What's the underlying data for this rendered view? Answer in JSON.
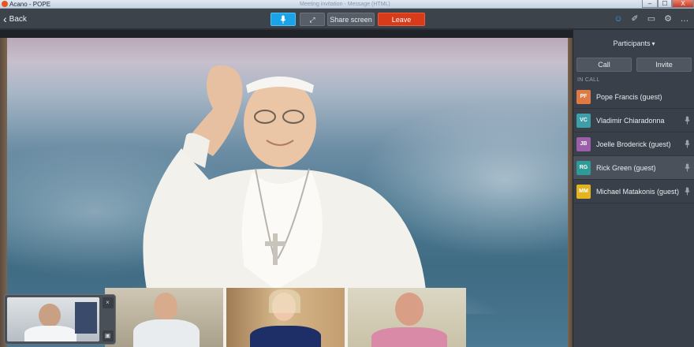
{
  "window": {
    "title": "Acano - POPE",
    "faint_title": "Meeting invitation - Message (HTML)",
    "min_symbol": "‒",
    "max_symbol": "☐",
    "close_symbol": "X"
  },
  "toolbar": {
    "back_label": "Back",
    "back_symbol": "‹",
    "mic_symbol": "↓",
    "expand_symbol": "⤢",
    "share_label": "Share screen",
    "leave_label": "Leave"
  },
  "top_icons": [
    {
      "icon": "participants-icon",
      "glyph": "☺"
    },
    {
      "icon": "chat-icon",
      "glyph": "✐"
    },
    {
      "icon": "screen-icon",
      "glyph": "▭"
    },
    {
      "icon": "settings-icon",
      "glyph": "⚙"
    },
    {
      "icon": "more-icon",
      "glyph": "…"
    }
  ],
  "panel": {
    "header": "Participants",
    "header_chevron": "▾",
    "call_label": "Call",
    "invite_label": "Invite",
    "section_label": "IN CALL",
    "participants": [
      {
        "initials": "PF",
        "name": "Pope Francis (guest)",
        "color": "#e07a45",
        "mic": false
      },
      {
        "initials": "VC",
        "name": "Vladimir Chiaradonna",
        "color": "#3f9fa8",
        "mic": true
      },
      {
        "initials": "JB",
        "name": "Joelle Broderick (guest)",
        "color": "#9a5fa8",
        "mic": true
      },
      {
        "initials": "RG",
        "name": "Rick Green (guest)",
        "color": "#2f9a96",
        "mic": true
      },
      {
        "initials": "MM",
        "name": "Michael Matakonis (guest)",
        "color": "#e3b420",
        "mic": true
      }
    ],
    "mic_glyph": "̲ "
  },
  "selfview": {
    "close_glyph": "×",
    "camera_glyph": "▣"
  },
  "colors": {
    "accent": "#1aa3e8",
    "leave": "#d83b1a",
    "panel_bg": "#3a4049"
  }
}
